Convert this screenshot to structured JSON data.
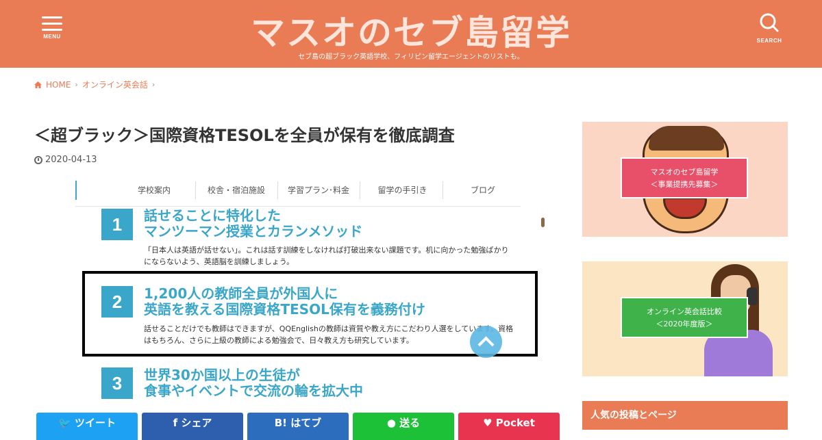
{
  "header": {
    "menu_label": "MENU",
    "search_label": "SEARCH",
    "site_title": "マスオのセブ島留学",
    "site_description": "セブ島の超ブラック英語学校、フィリピン留学エージェントのリストも。",
    "background_color": "#ea7c55"
  },
  "breadcrumb": {
    "home": "HOME",
    "category": "オンライン英会話"
  },
  "article": {
    "title": "＜超ブラック＞国際資格TESOLを全員が保有を徹底調査",
    "date": "2020-04-13"
  },
  "screenshot": {
    "nav": [
      "学校案内",
      "校舎・宿泊施設",
      "学習プラン･料金",
      "留学の手引き",
      "ブログ"
    ],
    "features": [
      {
        "number": "1",
        "heading_line1": "話せることに特化した",
        "heading_line2": "マンツーマン授業とカランメソッド",
        "text_line1": "「日本人は英語が話せない」。これは話す訓練をしなければ打破出来ない課題です。机に向かった勉強ばかり",
        "text_line2": "にならないよう、英語脳を訓練しましょう。"
      },
      {
        "number": "2",
        "heading_line1": "1,200人の教師全員が外国人に",
        "heading_line2": "英語を教える国際資格TESOL保有を義務付け",
        "text_line1": "話せることだけでも教師はできますが、QQEnglishの教師は資質や教え方にこだわり人選をしています。資格",
        "text_line2": "はもちろん、さらに上級の教師による勉強会で、日々教え方も研究しています。"
      },
      {
        "number": "3",
        "heading_line1": "世界30か国以上の生徒が",
        "heading_line2": "食事やイベントで交流の輪を拡大中"
      }
    ],
    "accent_color": "#3aa6c9"
  },
  "share": [
    {
      "label": "ツイート",
      "icon": "twitter-icon",
      "color": "#1da1f2"
    },
    {
      "label": "シェア",
      "icon": "facebook-icon",
      "color": "#2e5fae"
    },
    {
      "label": "はてブ",
      "icon": "hatena-icon",
      "color": "#2c6ebd"
    },
    {
      "label": "送る",
      "icon": "line-icon",
      "color": "#1dc137"
    },
    {
      "label": "Pocket",
      "icon": "pocket-icon",
      "color": "#e9344f"
    }
  ],
  "sidebar": {
    "banner1_line1": "マスオのセブ島留学",
    "banner1_line2": "＜事業提携先募集＞",
    "banner2_line1": "オンライン英会話比較",
    "banner2_line2": "＜2020年度版＞",
    "widget_title": "人気の投稿とページ"
  }
}
